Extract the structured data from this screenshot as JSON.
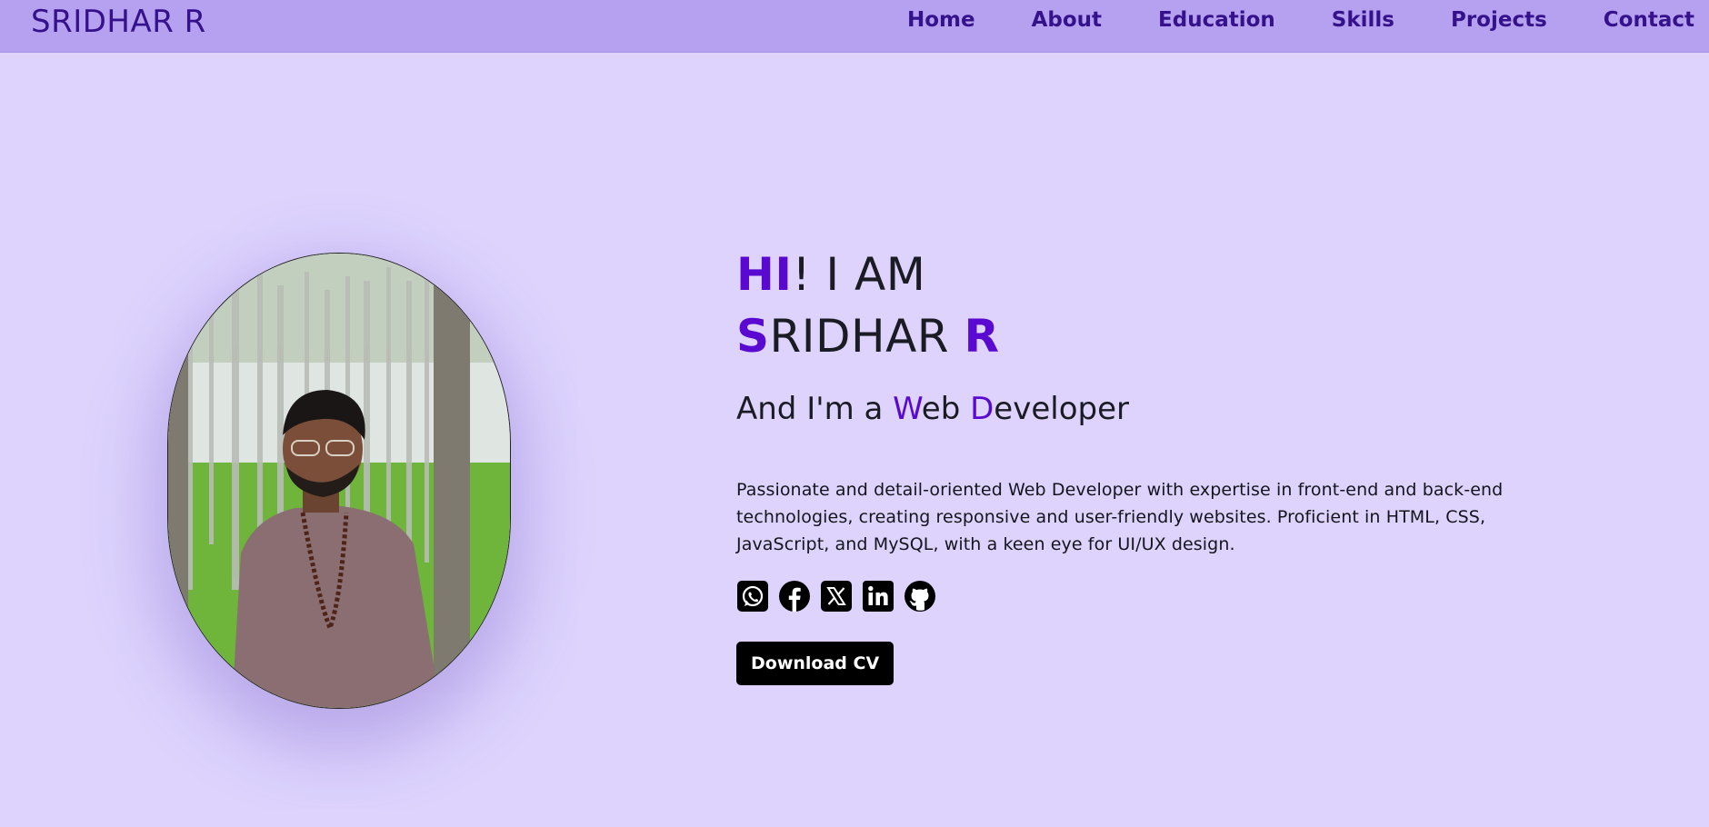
{
  "header": {
    "brand": "SRIDHAR R",
    "nav": [
      "Home",
      "About",
      "Education",
      "Skills",
      "Projects",
      "Contact"
    ]
  },
  "hero": {
    "greeting_accent": "HI",
    "greeting_rest": "! I AM",
    "name_first_letter": "S",
    "name_rest": "RIDHAR ",
    "name_initial": "R",
    "role_prefix": "And I'm a ",
    "role_w": "W",
    "role_w_rest": "eb ",
    "role_d": "D",
    "role_d_rest": "eveloper",
    "description": "Passionate and detail-oriented Web Developer with expertise in front-end and back-end technologies, creating responsive and user-friendly websites. Proficient in HTML, CSS, JavaScript, and MySQL, with a keen eye for UI/UX design.",
    "download_label": "Download CV"
  },
  "socials": [
    "whatsapp-icon",
    "facebook-icon",
    "x-twitter-icon",
    "linkedin-icon",
    "github-icon"
  ],
  "colors": {
    "page_bg": "#ddd3fd",
    "header_bg": "#b6a1f0",
    "brand_text": "#35128c",
    "accent": "#5a0ad0",
    "button_bg": "#000000"
  }
}
